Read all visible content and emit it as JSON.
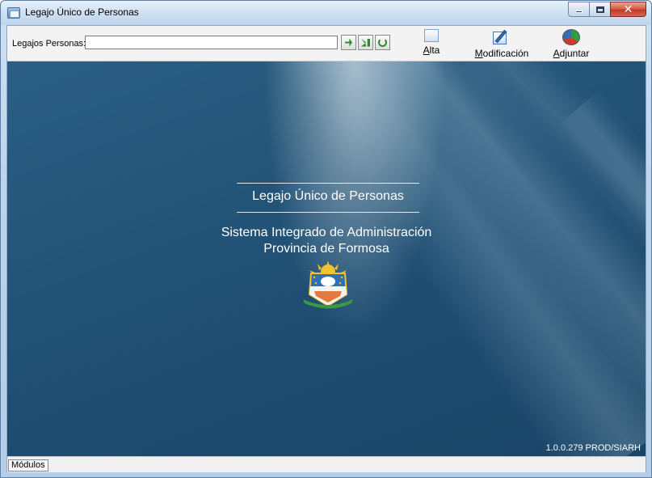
{
  "window": {
    "title": "Legajo Único de Personas",
    "controls": {
      "minimize": "minimize-icon",
      "maximize": "maximize-icon",
      "close": "✕"
    }
  },
  "toolbar": {
    "search_label": "Legajos Personas:",
    "search_value": "",
    "actions": [
      {
        "label": "Alta",
        "icon": "new-document-icon"
      },
      {
        "label": "Modificación",
        "icon": "edit-document-icon"
      },
      {
        "label": "Adjuntar",
        "icon": "attach-pie-icon"
      }
    ],
    "nav_icons": [
      "go-icon",
      "next-record-icon",
      "refresh-icon"
    ]
  },
  "splash": {
    "title": "Legajo Único de Personas",
    "subtitle_line1": "Sistema Integrado de Administración",
    "subtitle_line2": "Provincia de Formosa",
    "seal_icon": "province-seal-icon",
    "version": "1.0.0.279 PROD/SIARH"
  },
  "statusbar": {
    "modules_tab": "Módulos"
  },
  "colors": {
    "splash_background": "#1f4e72",
    "titlebar": "#cfe0f2",
    "close_button": "#c0392b"
  }
}
